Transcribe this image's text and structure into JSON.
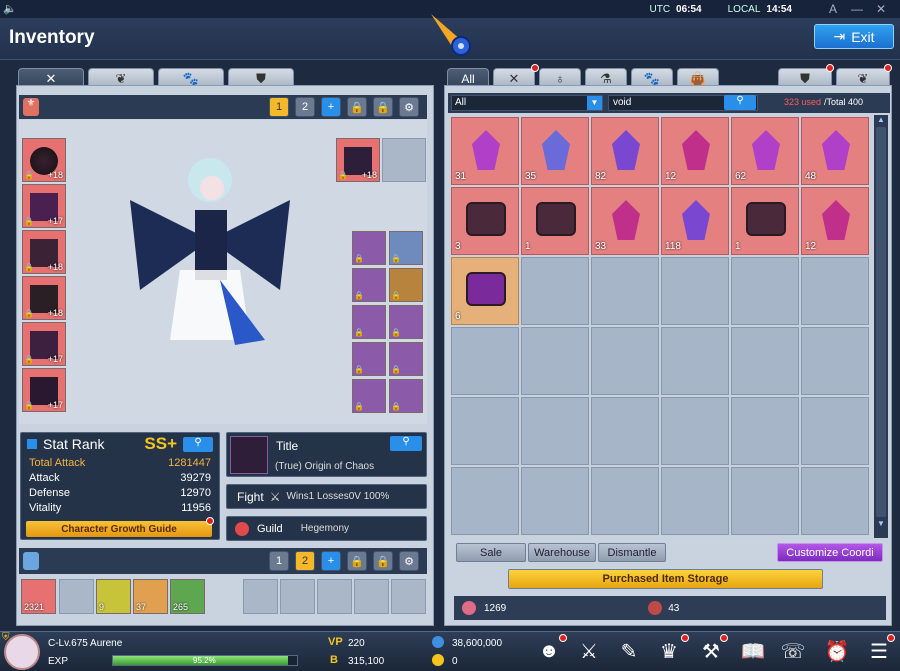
{
  "clock": {
    "utc_label": "UTC",
    "utc_time": "06:54",
    "local_label": "LOCAL",
    "local_time": "14:54"
  },
  "window": {
    "title": "Inventory",
    "exit_label": "Exit"
  },
  "left": {
    "preset_buttons": [
      "1",
      "2"
    ],
    "equip_slots_left": [
      "+18",
      "+17",
      "+18",
      "+18",
      "+17",
      "+17"
    ],
    "weapon_slot_count": "+18",
    "stat": {
      "title": "Stat Rank",
      "rank": "SS+",
      "rows": [
        {
          "label": "Total Attack",
          "value": "1281447"
        },
        {
          "label": "Attack",
          "value": "39279"
        },
        {
          "label": "Defense",
          "value": "12970"
        },
        {
          "label": "Vitality",
          "value": "11956"
        }
      ],
      "guide_label": "Character Growth Guide"
    },
    "title_box": {
      "label": "Title",
      "value": "(True) Origin of Chaos"
    },
    "fight": {
      "label": "Fight",
      "value": "Wins1 Losses0V 100%"
    },
    "guild": {
      "label": "Guild",
      "value": "Hegemony"
    },
    "consumables": [
      "2321",
      "",
      "9",
      "37",
      "265"
    ]
  },
  "right": {
    "tabs": [
      "All"
    ],
    "filter_select": "All",
    "search_value": "void",
    "capacity_used": "323 used",
    "capacity_total": "/Total 400",
    "items": [
      {
        "count": "31",
        "kind": "crystal-pink"
      },
      {
        "count": "35",
        "kind": "crystal-blue"
      },
      {
        "count": "82",
        "kind": "crystal-purple"
      },
      {
        "count": "12",
        "kind": "crystal-small"
      },
      {
        "count": "62",
        "kind": "crystal-pink"
      },
      {
        "count": "48",
        "kind": "crystal-pink"
      },
      {
        "count": "3",
        "kind": "chest"
      },
      {
        "count": "1",
        "kind": "chest"
      },
      {
        "count": "33",
        "kind": "crystal-small"
      },
      {
        "count": "118",
        "kind": "crystal-purple"
      },
      {
        "count": "1",
        "kind": "chest"
      },
      {
        "count": "12",
        "kind": "crystal-small"
      },
      {
        "count": "6",
        "kind": "box"
      }
    ],
    "buttons": {
      "sale": "Sale",
      "warehouse": "Warehouse",
      "dismantle": "Dismantle",
      "customize": "Customize Coordi",
      "storage": "Purchased Item Storage"
    },
    "currency_1": "1269",
    "currency_2": "43"
  },
  "bottom": {
    "character": "C-Lv.675 Aurene",
    "exp_label": "EXP",
    "exp_percent": "95.2%",
    "exp_fraction": 0.952,
    "vp_label": "VP",
    "vp_value": "220",
    "b_label": "B",
    "b_value": "315,100",
    "gold_value": "38,600,000",
    "coin_value": "0"
  }
}
